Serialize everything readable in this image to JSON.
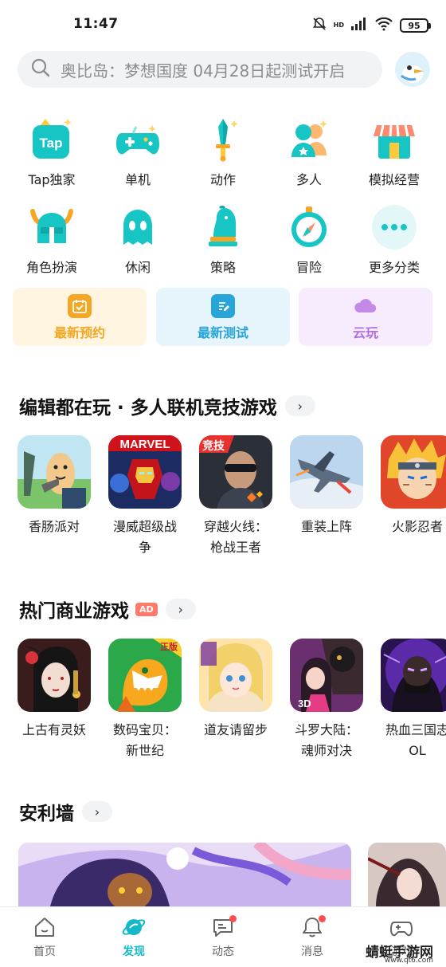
{
  "status": {
    "time": "11:47",
    "hd_label": "HD",
    "battery": "95"
  },
  "search": {
    "placeholder": "奥比岛：梦想国度 04月28日起测试开启"
  },
  "categories": [
    {
      "label": "Tap独家",
      "icon": "tap-logo-icon"
    },
    {
      "label": "单机",
      "icon": "gamepad-icon"
    },
    {
      "label": "动作",
      "icon": "sword-icon"
    },
    {
      "label": "多人",
      "icon": "people-icon"
    },
    {
      "label": "模拟经营",
      "icon": "shop-icon"
    },
    {
      "label": "角色扮演",
      "icon": "viking-helmet-icon"
    },
    {
      "label": "休闲",
      "icon": "ghost-icon"
    },
    {
      "label": "策略",
      "icon": "chess-knight-icon"
    },
    {
      "label": "冒险",
      "icon": "compass-icon"
    },
    {
      "label": "更多分类",
      "icon": "more-dots-icon"
    }
  ],
  "tap_logo_text": "Tap",
  "quick_tiles": [
    {
      "label": "最新预约",
      "color": "#f5a623",
      "bg": "#fff5e0"
    },
    {
      "label": "最新测试",
      "color": "#27a5d8",
      "bg": "#e6f4fb"
    },
    {
      "label": "云玩",
      "color": "#b06ee0",
      "bg": "#f6ecfd"
    }
  ],
  "sections": {
    "editor": {
      "title": "编辑都在玩 · 多人联机竞技游戏",
      "more": "›"
    },
    "hot": {
      "title": "热门商业游戏",
      "badge": "AD",
      "more": "›"
    },
    "wall": {
      "title": "安利墙",
      "more": "›"
    }
  },
  "editor_games": [
    {
      "name": "香肠派对"
    },
    {
      "name": "漫威超级战争"
    },
    {
      "name": "穿越火线：枪战王者"
    },
    {
      "name": "重装上阵"
    },
    {
      "name": "火影忍者"
    }
  ],
  "marvel_text": "MARVEL",
  "cf_badge": "竞技",
  "hot_games": [
    {
      "name": "上古有灵妖"
    },
    {
      "name": "数码宝贝：新世纪"
    },
    {
      "name": "道友请留步"
    },
    {
      "name": "斗罗大陆：魂师对决"
    },
    {
      "name": "热血三国志OL"
    }
  ],
  "digimon_badge": "正版",
  "douluo_badge": "3D",
  "nav": [
    {
      "label": "首页"
    },
    {
      "label": "发现"
    },
    {
      "label": "动态"
    },
    {
      "label": "消息"
    },
    {
      "label": "游戏"
    }
  ],
  "watermark": {
    "main": "蜻蜓手游网",
    "url": "www.qt6.com"
  }
}
